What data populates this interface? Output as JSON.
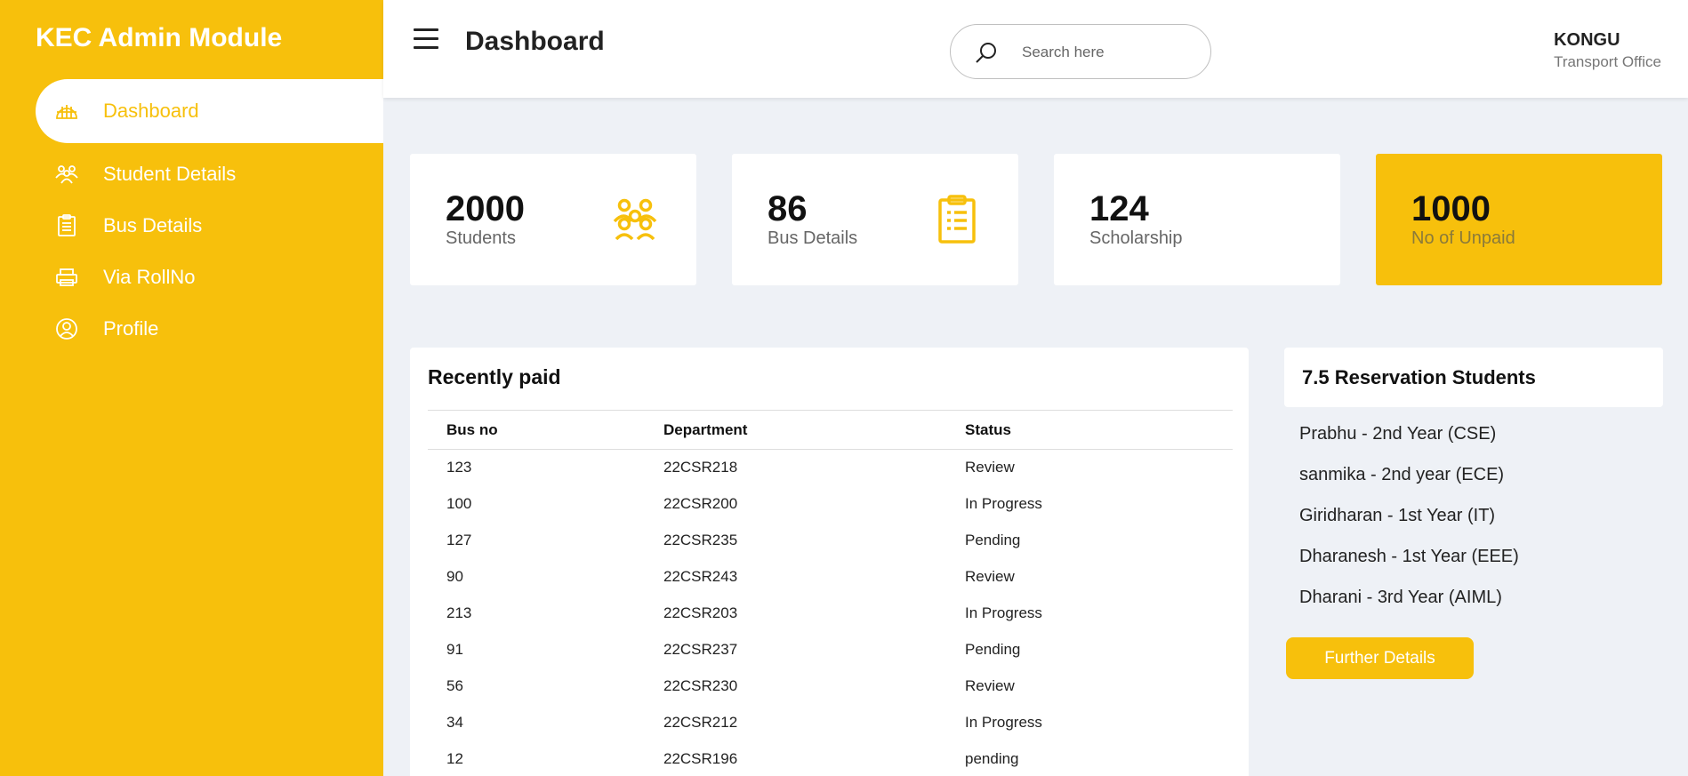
{
  "sidebar": {
    "brand": "KEC Admin Module",
    "items": [
      {
        "label": "Dashboard",
        "icon": "dashboard-icon"
      },
      {
        "label": "Student Details",
        "icon": "people-icon"
      },
      {
        "label": "Bus Details",
        "icon": "clipboard-icon"
      },
      {
        "label": "Via RollNo",
        "icon": "printer-icon"
      },
      {
        "label": "Profile",
        "icon": "user-circle-icon"
      }
    ]
  },
  "header": {
    "title": "Dashboard",
    "search_placeholder": "Search here",
    "user_org": "KONGU",
    "user_office": "Transport Office"
  },
  "stats": [
    {
      "value": "2000",
      "label": "Students",
      "icon": "people-icon"
    },
    {
      "value": "86",
      "label": "Bus Details",
      "icon": "clipboard-icon"
    },
    {
      "value": "124",
      "label": "Scholarship"
    },
    {
      "value": "1000",
      "label": "No of Unpaid"
    }
  ],
  "recent": {
    "title": "Recently paid",
    "columns": [
      "Bus no",
      "Department",
      "Status"
    ],
    "rows": [
      [
        "123",
        "22CSR218",
        "Review"
      ],
      [
        "100",
        "22CSR200",
        "In Progress"
      ],
      [
        "127",
        "22CSR235",
        "Pending"
      ],
      [
        "90",
        "22CSR243",
        "Review"
      ],
      [
        "213",
        "22CSR203",
        "In Progress"
      ],
      [
        "91",
        "22CSR237",
        "Pending"
      ],
      [
        "56",
        "22CSR230",
        "Review"
      ],
      [
        "34",
        "22CSR212",
        "In Progress"
      ],
      [
        "12",
        "22CSR196",
        "pending"
      ]
    ]
  },
  "reservation": {
    "title": "7.5 Reservation Students",
    "students": [
      "Prabhu - 2nd Year (CSE)",
      "sanmika - 2nd year (ECE)",
      "Giridharan - 1st Year (IT)",
      "Dharanesh - 1st Year (EEE)",
      "Dharani - 3rd Year (AIML)"
    ],
    "button_label": "Further Details"
  },
  "colors": {
    "accent": "#f7c00c",
    "background": "#eef1f6"
  }
}
